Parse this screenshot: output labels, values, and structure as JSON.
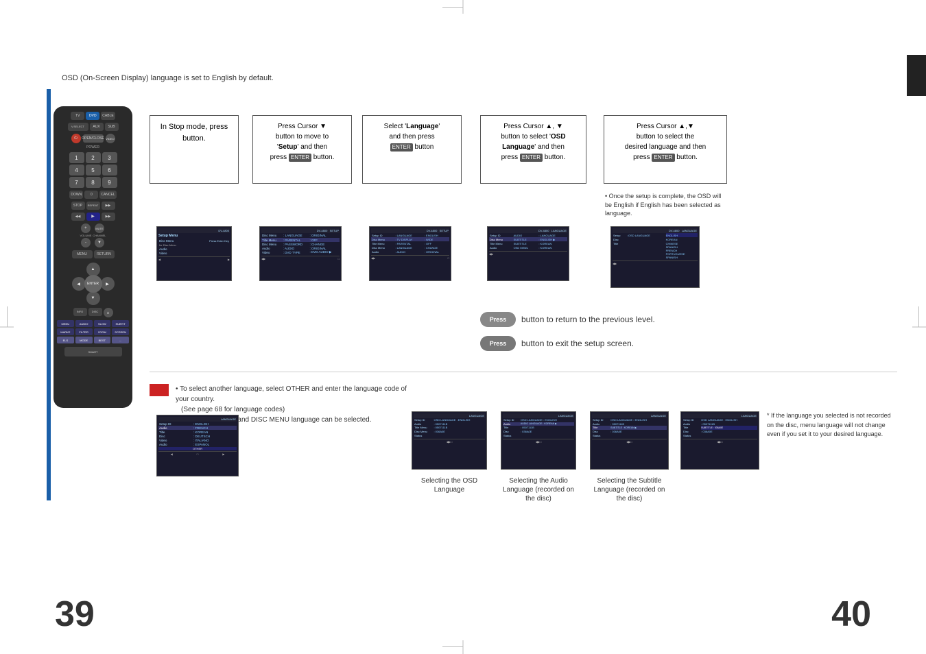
{
  "page": {
    "top_note": "OSD  (On-Screen Display) language is set to English by default.",
    "page_num_left": "39",
    "page_num_right": "40"
  },
  "step1": {
    "title": "In Stop mode, press button."
  },
  "step2": {
    "title": "Press Cursor ▼ button to move to ' ' and then press button."
  },
  "step3": {
    "title": "Select ' ' and then press button"
  },
  "step4": {
    "title": "Press Cursor ▲, ▼ button to select ' ' and then press button."
  },
  "step5": {
    "title": "Press Cursor ▲,▼ button to select the desired language and then press button."
  },
  "step5_note": "• Once the setup is complete, the OSD will be English if English has been selected as language.",
  "return_btn": "Press",
  "return_text": "button to return to the previous level.",
  "exit_btn": "Press",
  "exit_text": "button to exit the setup screen.",
  "bottom_note1": "• To select another language, select OTHER and enter the language code of your country.",
  "bottom_note2": "(See page 68 for language codes)",
  "bottom_note3": "AUDIO, SUB TITLE and DISC MENU language can be selected.",
  "labels": {
    "osd": "Selecting the OSD Language",
    "audio": "Selecting the Audio Language (recorded on the disc)",
    "subtitle": "Selecting the Subtitle Language (recorded on the disc)",
    "note_if": "* If the language you selected is not recorded on the disc, menu language will not change even if you set it to your desired language."
  }
}
